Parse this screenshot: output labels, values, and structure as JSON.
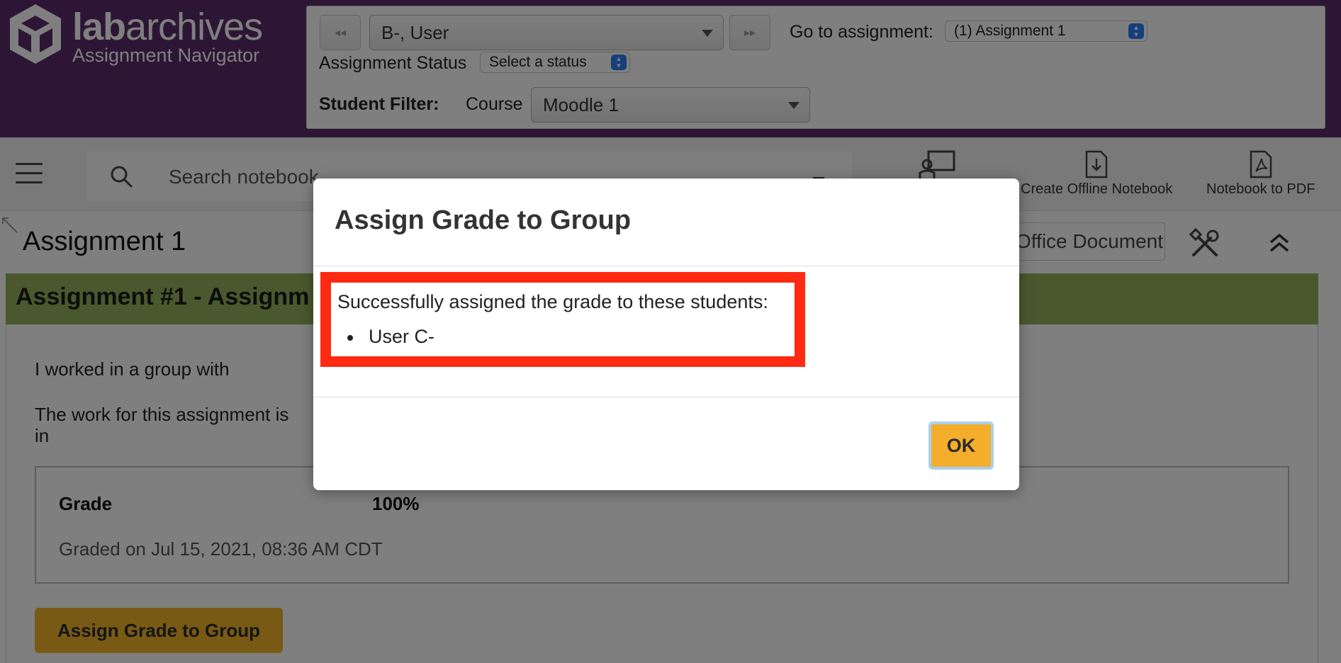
{
  "header": {
    "brand_bold": "lab",
    "brand_rest": "archives",
    "subtitle": "Assignment Navigator",
    "prev_icon": "◂◂",
    "next_icon": "▸▸",
    "student_select": "B-, User",
    "goto_label": "Go to assignment:",
    "goto_value": "(1) Assignment 1",
    "status_label": "Assignment Status",
    "status_value": "Select a status",
    "filter_label": "Student Filter:",
    "course_label": "Course",
    "course_value": "Moodle 1"
  },
  "toolbar": {
    "search_placeholder": "Search notebook",
    "create_offline_label": "Create Offline Notebook",
    "notebook_pdf_label": "Notebook to PDF"
  },
  "content": {
    "page_title": "Assignment 1",
    "office_button": "Office Document",
    "green_bar_title": "Assignment #1 - Assignm",
    "group_text": "I worked in a group with",
    "work_text_line1": "The work for this assignment is",
    "work_text_line2": "in",
    "grade_label": "Grade",
    "grade_value": "100%",
    "graded_on": "Graded on Jul 15, 2021, 08:36 AM CDT",
    "assign_button": "Assign Grade to Group"
  },
  "modal": {
    "title": "Assign Grade to Group",
    "message": "Successfully assigned the grade to these students:",
    "students": [
      "User C-"
    ],
    "ok_button": "OK"
  },
  "colors": {
    "header_purple": "#5a2c6b",
    "green_bar": "#93b25a",
    "accent_orange": "#f1b52a",
    "highlight_red": "#ff2a12"
  }
}
